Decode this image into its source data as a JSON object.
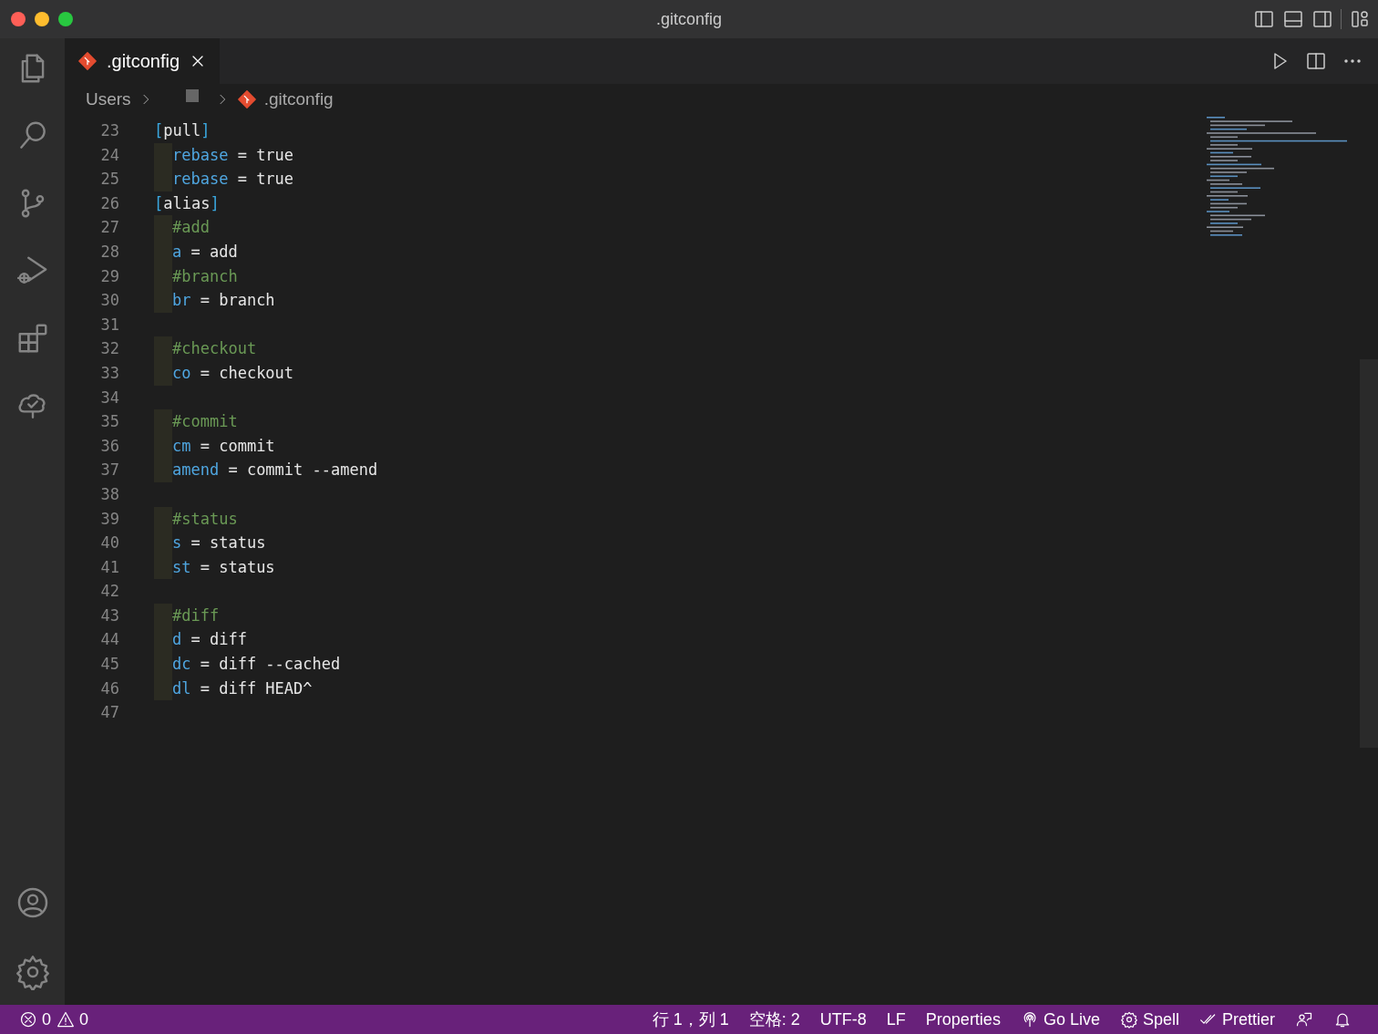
{
  "window": {
    "title": ".gitconfig"
  },
  "tabs": [
    {
      "label": ".gitconfig",
      "selected": true
    }
  ],
  "breadcrumb": [
    {
      "kind": "text",
      "label": "Users"
    },
    {
      "kind": "hidden"
    },
    {
      "kind": "file",
      "label": ".gitconfig"
    }
  ],
  "lines": [
    {
      "number": "23",
      "indented": false,
      "tokens": [
        {
          "kind": "bracket",
          "text": "["
        },
        {
          "kind": "plain",
          "text": "pull"
        },
        {
          "kind": "bracket",
          "text": "]"
        }
      ]
    },
    {
      "number": "24",
      "indented": true,
      "tokens": [
        {
          "kind": "key",
          "text": "rebase"
        },
        {
          "kind": "plain",
          "text": " = true"
        }
      ]
    },
    {
      "number": "25",
      "indented": true,
      "tokens": [
        {
          "kind": "key",
          "text": "rebase"
        },
        {
          "kind": "plain",
          "text": " = true"
        }
      ]
    },
    {
      "number": "26",
      "indented": false,
      "tokens": [
        {
          "kind": "bracket",
          "text": "["
        },
        {
          "kind": "plain",
          "text": "alias"
        },
        {
          "kind": "bracket",
          "text": "]"
        }
      ]
    },
    {
      "number": "27",
      "indented": true,
      "tokens": [
        {
          "kind": "comment",
          "text": "#add"
        }
      ]
    },
    {
      "number": "28",
      "indented": true,
      "tokens": [
        {
          "kind": "key",
          "text": "a"
        },
        {
          "kind": "plain",
          "text": " = add"
        }
      ]
    },
    {
      "number": "29",
      "indented": true,
      "tokens": [
        {
          "kind": "comment",
          "text": "#branch"
        }
      ]
    },
    {
      "number": "30",
      "indented": true,
      "tokens": [
        {
          "kind": "key",
          "text": "br"
        },
        {
          "kind": "plain",
          "text": " = branch"
        }
      ]
    },
    {
      "number": "31",
      "indented": false
    },
    {
      "number": "32",
      "indented": true,
      "tokens": [
        {
          "kind": "comment",
          "text": "#checkout"
        }
      ]
    },
    {
      "number": "33",
      "indented": true,
      "tokens": [
        {
          "kind": "key",
          "text": "co"
        },
        {
          "kind": "plain",
          "text": " = checkout"
        }
      ]
    },
    {
      "number": "34",
      "indented": false
    },
    {
      "number": "35",
      "indented": true,
      "tokens": [
        {
          "kind": "comment",
          "text": "#commit"
        }
      ]
    },
    {
      "number": "36",
      "indented": true,
      "tokens": [
        {
          "kind": "key",
          "text": "cm"
        },
        {
          "kind": "plain",
          "text": " = commit"
        }
      ]
    },
    {
      "number": "37",
      "indented": true,
      "tokens": [
        {
          "kind": "key",
          "text": "amend"
        },
        {
          "kind": "plain",
          "text": " = commit --amend"
        }
      ]
    },
    {
      "number": "38",
      "indented": false
    },
    {
      "number": "39",
      "indented": true,
      "tokens": [
        {
          "kind": "comment",
          "text": "#status"
        }
      ]
    },
    {
      "number": "40",
      "indented": true,
      "tokens": [
        {
          "kind": "key",
          "text": "s"
        },
        {
          "kind": "plain",
          "text": " = status"
        }
      ]
    },
    {
      "number": "41",
      "indented": true,
      "tokens": [
        {
          "kind": "key",
          "text": "st"
        },
        {
          "kind": "plain",
          "text": " = status"
        }
      ]
    },
    {
      "number": "42",
      "indented": false
    },
    {
      "number": "43",
      "indented": true,
      "tokens": [
        {
          "kind": "comment",
          "text": "#diff"
        }
      ]
    },
    {
      "number": "44",
      "indented": true,
      "tokens": [
        {
          "kind": "key",
          "text": "d"
        },
        {
          "kind": "plain",
          "text": " = diff"
        }
      ]
    },
    {
      "number": "45",
      "indented": true,
      "tokens": [
        {
          "kind": "key",
          "text": "dc"
        },
        {
          "kind": "plain",
          "text": " = diff --cached"
        }
      ]
    },
    {
      "number": "46",
      "indented": true,
      "tokens": [
        {
          "kind": "key",
          "text": "dl"
        },
        {
          "kind": "plain",
          "text": " = diff HEAD^"
        }
      ]
    },
    {
      "number": "47",
      "indented": false
    }
  ],
  "status_bar": {
    "left": [
      {
        "kind": "error",
        "label": "0"
      },
      {
        "kind": "warning",
        "label": "0"
      }
    ],
    "right": [
      {
        "kind": "text",
        "label": "行 1，列 1"
      },
      {
        "kind": "text",
        "label": "空格: 2"
      },
      {
        "kind": "text",
        "label": "UTF-8"
      },
      {
        "kind": "text",
        "label": "LF"
      },
      {
        "kind": "text",
        "label": "Properties"
      },
      {
        "kind": "golive",
        "label": "Go Live"
      },
      {
        "kind": "spell",
        "label": "Spell"
      },
      {
        "kind": "prettier",
        "label": "Prettier"
      },
      {
        "kind": "feedback"
      },
      {
        "kind": "bell"
      }
    ]
  }
}
